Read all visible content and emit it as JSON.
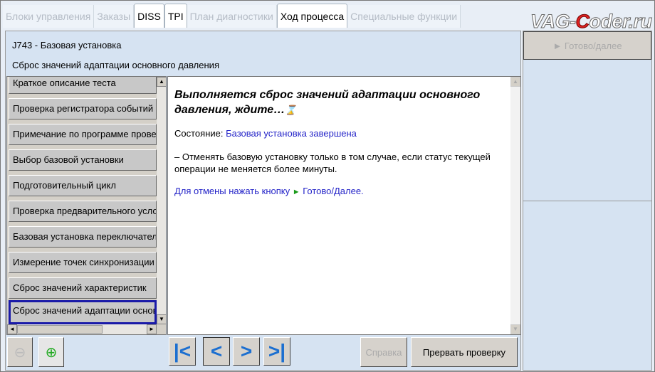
{
  "tabs": [
    "Блоки управления",
    "Заказы",
    "DISS",
    "TPI",
    "План диагностики",
    "Ход процесса",
    "Специальные функции"
  ],
  "logo": {
    "pre": "VAG-",
    "c": "C",
    "post": "oder.ru"
  },
  "header": {
    "line1": "J743 - Базовая установка",
    "line2": "Сброс значений адаптации основного давления"
  },
  "list": [
    "Краткое описание теста",
    "Проверка регистратора событий",
    "Примечание по программе проверки",
    "Выбор базовой установки",
    "Подготовительный цикл",
    "Проверка предварительного условия",
    "Базовая установка переключателя",
    "Измерение точек синхронизации",
    "Сброс значений характеристик",
    "Сброс значений адаптации основного давления"
  ],
  "content": {
    "title": "Выполняется сброс значений адаптации основного давления, ждите…",
    "hourglass": "⌛",
    "state_label": "Состояние: ",
    "state_value": "Базовая установка завершена",
    "note": "– Отменять базовую установку только в том случае, если статус текущей операции не меняется более минуты.",
    "cancel_text": "Для отмены нажать кнопку ",
    "cancel_play": "►",
    "cancel_btn": " Готово/Далее."
  },
  "buttons": {
    "help": "Справка",
    "abort": "Прервать проверку",
    "next": "► Готово/далее"
  },
  "colors": {
    "accent": "#1c6fd0",
    "link": "#2424c8",
    "selected": "#1a1aa8"
  }
}
